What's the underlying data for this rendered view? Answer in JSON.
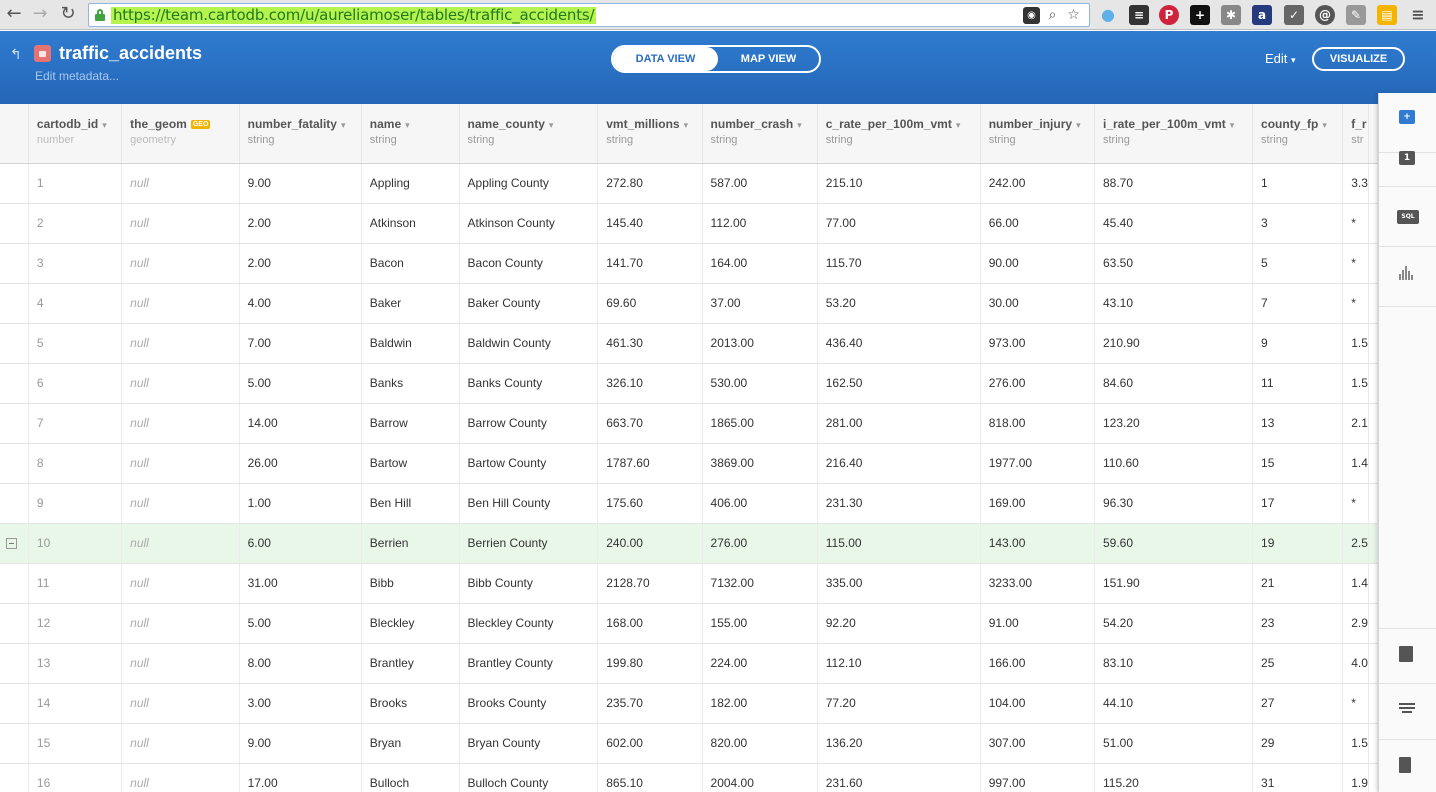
{
  "browser": {
    "url": "https://team.cartodb.com/u/aureliamoser/tables/traffic_accidents/"
  },
  "header": {
    "title": "traffic_accidents",
    "subtitle": "Edit metadata...",
    "data_view": "DATA VIEW",
    "map_view": "MAP VIEW",
    "edit": "Edit",
    "visualize": "VISUALIZE"
  },
  "table": {
    "columns": [
      {
        "name": "cartodb_id",
        "type": "number"
      },
      {
        "name": "the_geom",
        "type": "geometry",
        "badge": "GEO"
      },
      {
        "name": "number_fatality",
        "type": "string"
      },
      {
        "name": "name",
        "type": "string"
      },
      {
        "name": "name_county",
        "type": "string"
      },
      {
        "name": "vmt_millions",
        "type": "string"
      },
      {
        "name": "number_crash",
        "type": "string"
      },
      {
        "name": "c_rate_per_100m_vmt",
        "type": "string"
      },
      {
        "name": "number_injury",
        "type": "string"
      },
      {
        "name": "i_rate_per_100m_vmt",
        "type": "string"
      },
      {
        "name": "county_fp",
        "type": "string"
      },
      {
        "name": "f_r",
        "type": "str"
      }
    ],
    "rows": [
      [
        "1",
        "null",
        "9.00",
        "Appling",
        "Appling County",
        "272.80",
        "587.00",
        "215.10",
        "242.00",
        "88.70",
        "1",
        "3.3"
      ],
      [
        "2",
        "null",
        "2.00",
        "Atkinson",
        "Atkinson County",
        "145.40",
        "112.00",
        "77.00",
        "66.00",
        "45.40",
        "3",
        "*"
      ],
      [
        "3",
        "null",
        "2.00",
        "Bacon",
        "Bacon County",
        "141.70",
        "164.00",
        "115.70",
        "90.00",
        "63.50",
        "5",
        "*"
      ],
      [
        "4",
        "null",
        "4.00",
        "Baker",
        "Baker County",
        "69.60",
        "37.00",
        "53.20",
        "30.00",
        "43.10",
        "7",
        "*"
      ],
      [
        "5",
        "null",
        "7.00",
        "Baldwin",
        "Baldwin County",
        "461.30",
        "2013.00",
        "436.40",
        "973.00",
        "210.90",
        "9",
        "1.5"
      ],
      [
        "6",
        "null",
        "5.00",
        "Banks",
        "Banks County",
        "326.10",
        "530.00",
        "162.50",
        "276.00",
        "84.60",
        "11",
        "1.5"
      ],
      [
        "7",
        "null",
        "14.00",
        "Barrow",
        "Barrow County",
        "663.70",
        "1865.00",
        "281.00",
        "818.00",
        "123.20",
        "13",
        "2.1"
      ],
      [
        "8",
        "null",
        "26.00",
        "Bartow",
        "Bartow County",
        "1787.60",
        "3869.00",
        "216.40",
        "1977.00",
        "110.60",
        "15",
        "1.4"
      ],
      [
        "9",
        "null",
        "1.00",
        "Ben Hill",
        "Ben Hill County",
        "175.60",
        "406.00",
        "231.30",
        "169.00",
        "96.30",
        "17",
        "*"
      ],
      [
        "10",
        "null",
        "6.00",
        "Berrien",
        "Berrien County",
        "240.00",
        "276.00",
        "115.00",
        "143.00",
        "59.60",
        "19",
        "2.5"
      ],
      [
        "11",
        "null",
        "31.00",
        "Bibb",
        "Bibb County",
        "2128.70",
        "7132.00",
        "335.00",
        "3233.00",
        "151.90",
        "21",
        "1.4"
      ],
      [
        "12",
        "null",
        "5.00",
        "Bleckley",
        "Bleckley County",
        "168.00",
        "155.00",
        "92.20",
        "91.00",
        "54.20",
        "23",
        "2.9"
      ],
      [
        "13",
        "null",
        "8.00",
        "Brantley",
        "Brantley County",
        "199.80",
        "224.00",
        "112.10",
        "166.00",
        "83.10",
        "25",
        "4.0"
      ],
      [
        "14",
        "null",
        "3.00",
        "Brooks",
        "Brooks County",
        "235.70",
        "182.00",
        "77.20",
        "104.00",
        "44.10",
        "27",
        "*"
      ],
      [
        "15",
        "null",
        "9.00",
        "Bryan",
        "Bryan County",
        "602.00",
        "820.00",
        "136.20",
        "307.00",
        "51.00",
        "29",
        "1.5"
      ],
      [
        "16",
        "null",
        "17.00",
        "Bulloch",
        "Bulloch County",
        "865.10",
        "2004.00",
        "231.60",
        "997.00",
        "115.20",
        "31",
        "1.9"
      ]
    ],
    "selected_row": 9
  },
  "sidebar": {
    "sql": "SQL",
    "one": "1",
    "add": "+"
  }
}
